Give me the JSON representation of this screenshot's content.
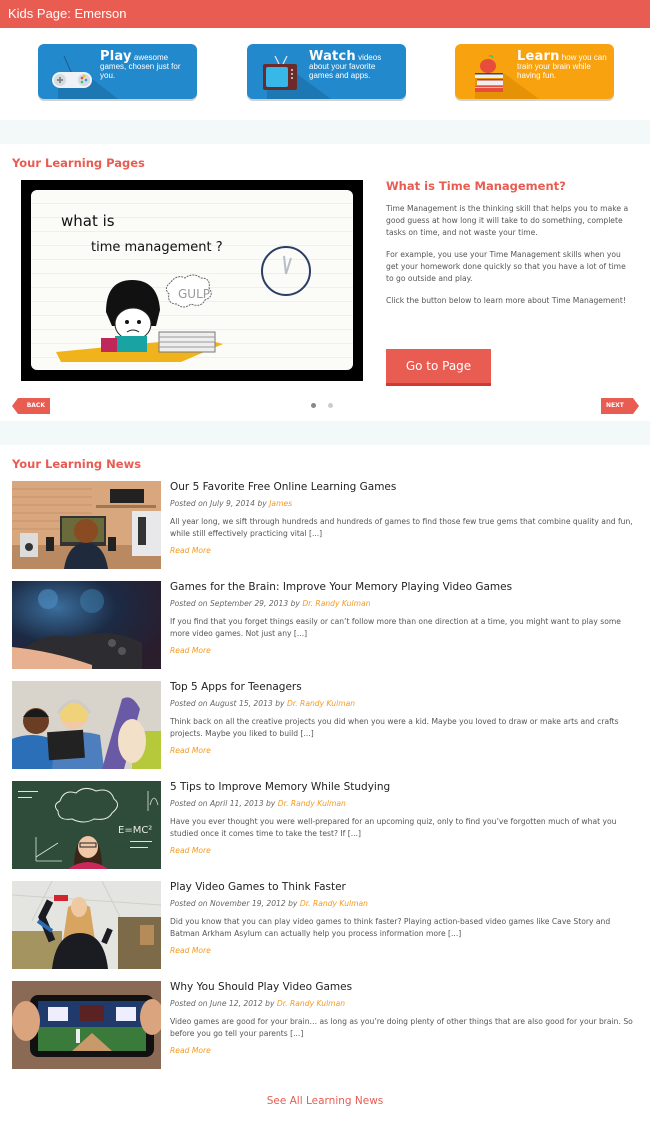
{
  "header": {
    "title": "Kids Page: Emerson"
  },
  "banners": [
    {
      "headline": "Play",
      "text": "awesome games, chosen just for you.",
      "icon": "gamepad-icon",
      "color": "#2389cd"
    },
    {
      "headline": "Watch",
      "text": "videos about your favorite games and apps.",
      "icon": "tv-icon",
      "color": "#2389cd"
    },
    {
      "headline": "Learn",
      "text": "how you can train your brain while having fun.",
      "icon": "apple-books-icon",
      "color": "#f9a20f"
    }
  ],
  "learning_pages": {
    "section_title": "Your Learning Pages",
    "video": {
      "line1": "what is",
      "line2": "time management ?",
      "bubble": "GULP"
    },
    "title": "What is Time Management?",
    "paragraphs": [
      "Time Management is the thinking skill that helps you to make a good guess at how long it will take to do something, complete tasks on time, and not waste your time.",
      "For example, you use your Time Management skills when you get your homework done quickly so that you have a lot of time to go outside and play.",
      "Click the button below to learn more about Time Management!"
    ],
    "button_label": "Go to Page",
    "back_label": "BACK",
    "next_label": "NEXT",
    "slides_total": 2,
    "slide_active": 1
  },
  "news": {
    "section_title": "Your Learning News",
    "posted_prefix": "Posted on",
    "by_word": "by",
    "read_more": "Read More",
    "articles": [
      {
        "title": "Our 5 Favorite Free Online Learning Games",
        "date": "July 9, 2014",
        "author": "James",
        "excerpt": "All year long, we sift through hundreds and hundreds of games to find those few true gems that combine quality and fun, while still effectively practicing vital [...]",
        "image": "child-at-computer"
      },
      {
        "title": "Games for the Brain: Improve Your Memory Playing Video Games",
        "date": "September 29, 2013",
        "author": "Dr. Randy Kulman",
        "excerpt": "If you find that you forget things easily or can’t follow more than one direction at a time, you might want to play some more video games. Not just any [...]",
        "image": "game-controller"
      },
      {
        "title": "Top 5 Apps for Teenagers",
        "date": "August 15, 2013",
        "author": "Dr. Randy Kulman",
        "excerpt": "Think back on all the creative projects you did when you were a kid. Maybe you loved to  draw or make arts and crafts projects. Maybe you liked to build [...]",
        "image": "teens-with-tablet"
      },
      {
        "title": "5 Tips to Improve Memory While Studying",
        "date": "April 11, 2013",
        "author": "Dr. Randy Kulman",
        "excerpt": "Have you ever thought you were well-prepared for an upcoming quiz, only to find you’ve forgotten much of what you studied once it comes time to take the test? If [...]",
        "image": "girl-chalkboard"
      },
      {
        "title": "Play Video Games to Think Faster",
        "date": "November 19, 2012",
        "author": "Dr. Randy Kulman",
        "excerpt": "Did you know that you can play video games to think faster? Playing action-based video games like Cave Story and Batman Arkham Asylum can actually help you process information more [...]",
        "image": "woman-motion-game"
      },
      {
        "title": "Why You Should Play Video Games",
        "date": "June 12, 2012",
        "author": "Dr. Randy Kulman",
        "excerpt": "Video games are good for your brain… as long as you’re doing plenty of other things that are also good for your brain. So before you go tell your parents [...]",
        "image": "phone-baseball-game"
      }
    ],
    "see_all_label": "See All Learning News"
  }
}
